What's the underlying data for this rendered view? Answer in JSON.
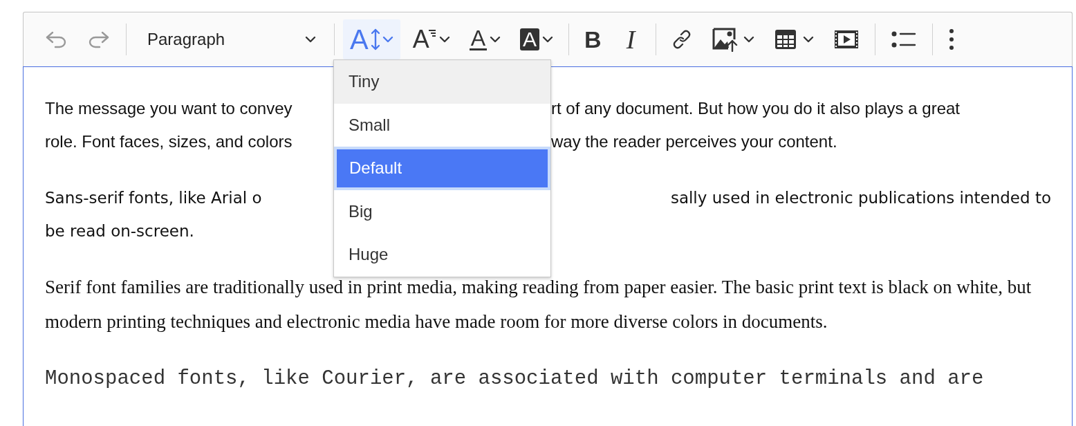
{
  "toolbar": {
    "items": [
      {
        "kind": "undo",
        "disabled": true,
        "open": false
      },
      {
        "kind": "redo",
        "disabled": true,
        "open": false
      },
      {
        "kind": "separator"
      },
      {
        "kind": "heading",
        "label": "Paragraph",
        "disabled": false,
        "open": false
      },
      {
        "kind": "separator"
      },
      {
        "kind": "font-size",
        "glyph": "A",
        "disabled": false,
        "open": true
      },
      {
        "kind": "font-family",
        "glyph": "A",
        "disabled": false,
        "open": false
      },
      {
        "kind": "font-color",
        "glyph": "A",
        "disabled": false,
        "open": false
      },
      {
        "kind": "font-background",
        "glyph": "A",
        "disabled": false,
        "open": false
      },
      {
        "kind": "separator"
      },
      {
        "kind": "bold",
        "glyph": "B",
        "disabled": false,
        "open": false
      },
      {
        "kind": "italic",
        "glyph": "I",
        "disabled": false,
        "open": false
      },
      {
        "kind": "separator"
      },
      {
        "kind": "link",
        "disabled": false,
        "open": false
      },
      {
        "kind": "image",
        "disabled": false,
        "open": false
      },
      {
        "kind": "table",
        "disabled": false,
        "open": false
      },
      {
        "kind": "media",
        "disabled": false,
        "open": false
      },
      {
        "kind": "separator"
      },
      {
        "kind": "bullet-list",
        "disabled": false,
        "open": false
      },
      {
        "kind": "separator"
      },
      {
        "kind": "more",
        "disabled": false,
        "open": false
      }
    ]
  },
  "font_size_menu": {
    "items": [
      {
        "label": "Tiny",
        "selected": false,
        "hovered": true
      },
      {
        "label": "Small",
        "selected": false,
        "hovered": false
      },
      {
        "label": "Default",
        "selected": true,
        "hovered": false
      },
      {
        "label": "Big",
        "selected": false,
        "hovered": false
      },
      {
        "label": "Huge",
        "selected": false,
        "hovered": false
      }
    ]
  },
  "content": {
    "paragraphs": [
      {
        "kind": "sans",
        "lines": [
          {
            "left": "The message you want to convey",
            "right": "rt of any document. But how you do it also plays a great"
          },
          {
            "left": "role. Font faces, sizes, and colors",
            "right": "way the reader perceives your content."
          }
        ]
      },
      {
        "kind": "wide-sans",
        "lines": [
          {
            "left": "Sans-serif fonts, like Arial o",
            "right": "sally used in electronic publications intended to"
          },
          {
            "left": "be read on-screen."
          }
        ]
      },
      {
        "kind": "serif",
        "text": "Serif font families are traditionally used in print media, making reading from paper easier. The basic print text is black on white, but modern printing techniques and electronic media have made room for more diverse colors in documents."
      },
      {
        "kind": "mono",
        "text": "Monospaced fonts, like Courier, are associated with computer terminals and are"
      }
    ]
  }
}
